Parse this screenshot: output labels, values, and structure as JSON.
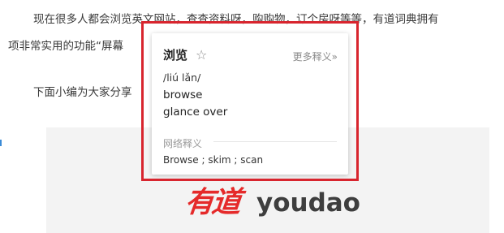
{
  "article": {
    "line1": "现在很多人都会浏览英文网站，查查资料呀，购购物，订个房呀等等，有道词典拥有",
    "line2": "项非常实用的功能“屏幕",
    "line3": "下面小编为大家分享"
  },
  "logo": {
    "cn": "有道",
    "en": "youdao"
  },
  "popup": {
    "word": "浏览",
    "star_icon": "☆",
    "more_label": "更多释义»",
    "phonetic": "/liú lǎn/",
    "meanings": [
      "browse",
      "glance over"
    ],
    "web_section_title": "网络释义",
    "web_meaning": "Browse ; skim ; scan"
  },
  "colors": {
    "highlight_border": "#d8252e",
    "logo_red": "#e52a2a",
    "logo_gray": "#3e3e3e"
  }
}
